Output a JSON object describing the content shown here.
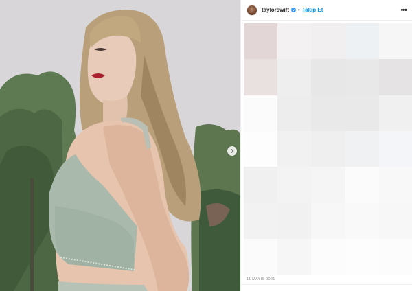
{
  "post": {
    "username": "taylorswift",
    "follow_label": "Takip Et",
    "separator": "•",
    "more_label": "•••",
    "date": "11 MAYIS 2021"
  },
  "icons": {
    "verified": "verified-badge-icon",
    "next": "chevron-right-icon",
    "more": "more-options-icon"
  },
  "colors": {
    "accent": "#0095f6",
    "text": "#262626",
    "muted": "#8e8e8e"
  },
  "comments_blur": {
    "tiles": [
      "#e2d6d6",
      "#f3f1f1",
      "#f1efef",
      "#eef1f4",
      "#f6f6f6",
      "#e8e1df",
      "#eeeeee",
      "#e7e7e7",
      "#e8e8e8",
      "#e5e3e3",
      "#fbfbfb",
      "#ededed",
      "#e9e9e9",
      "#e9e9e9",
      "#f0f0f0",
      "#fdfdfd",
      "#f1f1f1",
      "#efefef",
      "#f0f1f3",
      "#f4f5f8",
      "#f0f0f0",
      "#f3f3f3",
      "#f5f5f5",
      "#fbfbfb",
      "#f8f8f8",
      "#f2f2f2",
      "#f1f1f1",
      "#f7f7f7",
      "#f9f9f9",
      "#f7f7f7",
      "#fbfbfb",
      "#f6f6f6",
      "#fcfcfc",
      "#fdfdfd",
      "#fcfcfc"
    ]
  }
}
